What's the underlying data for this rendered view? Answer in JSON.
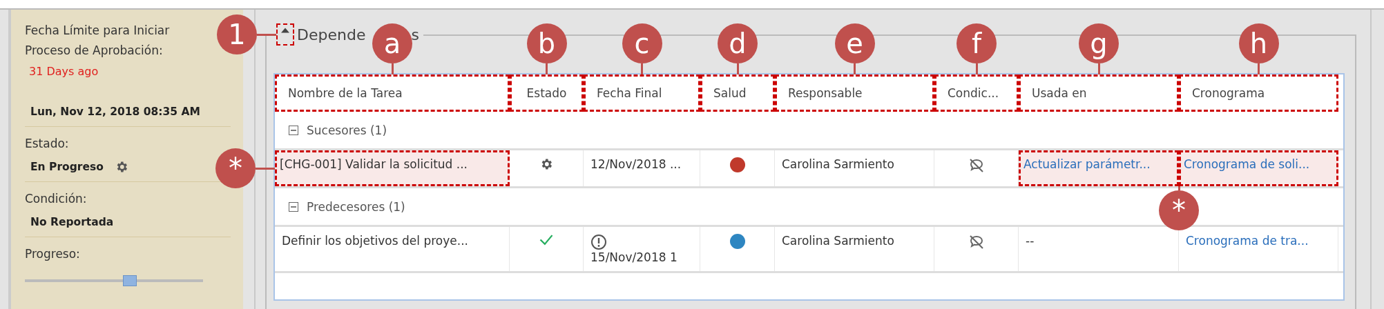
{
  "sidebar": {
    "fields": [
      {
        "label": "Fecha Límite para Iniciar Proceso de Aprobación:",
        "kind": "deadline",
        "alert_text": "31 Days ago",
        "value": "Lun, Nov 12, 2018 08:35 AM"
      },
      {
        "label": "Estado:",
        "kind": "status",
        "value": "En Progreso"
      },
      {
        "label": "Condición:",
        "kind": "text",
        "value": "No Reportada"
      },
      {
        "label": "Progreso:",
        "kind": "slider",
        "level": 0.59
      }
    ]
  },
  "section": {
    "legend_parts": [
      "Depende",
      "s"
    ],
    "expanded": true,
    "callout": "1"
  },
  "table": {
    "columns": [
      {
        "label": "Nombre de la Tarea",
        "callout": "a"
      },
      {
        "label": "Estado",
        "callout": "b"
      },
      {
        "label": "Fecha Final",
        "callout": "c"
      },
      {
        "label": "Salud",
        "callout": "d"
      },
      {
        "label": "Responsable",
        "callout": "e"
      },
      {
        "label": "Condic...",
        "callout": "f"
      },
      {
        "label": "Usada en",
        "callout": "g"
      },
      {
        "label": "Cronograma",
        "callout": "h"
      }
    ],
    "groups": [
      {
        "label": "Sucesores (1)",
        "expanded": true,
        "rows": [
          {
            "highlighted": true,
            "callout": "*",
            "cells": [
              {
                "kind": "text",
                "text": "[CHG-001] Validar la solicitud ...",
                "marked": true
              },
              {
                "kind": "gear"
              },
              {
                "kind": "date",
                "text": "12/Nov/2018 ...",
                "warning": false
              },
              {
                "kind": "health",
                "color": "#c0392b"
              },
              {
                "kind": "text",
                "text": "Carolina Sarmiento"
              },
              {
                "kind": "condition"
              },
              {
                "kind": "link",
                "text": "Actualizar parámetr...",
                "marked": true
              },
              {
                "kind": "link",
                "text": "Cronograma de soli...",
                "marked": true
              }
            ]
          }
        ]
      },
      {
        "label": "Predecesores (1)",
        "expanded": true,
        "rows": [
          {
            "highlighted": false,
            "cells": [
              {
                "kind": "text",
                "text": "Definir los objetivos del proye..."
              },
              {
                "kind": "check"
              },
              {
                "kind": "date",
                "text": "15/Nov/2018 1",
                "warning": true
              },
              {
                "kind": "health",
                "color": "#2e86c1"
              },
              {
                "kind": "text",
                "text": "Carolina Sarmiento"
              },
              {
                "kind": "condition"
              },
              {
                "kind": "text",
                "text": "--"
              },
              {
                "kind": "link",
                "text": "Cronograma de tra..."
              }
            ]
          }
        ]
      }
    ]
  }
}
